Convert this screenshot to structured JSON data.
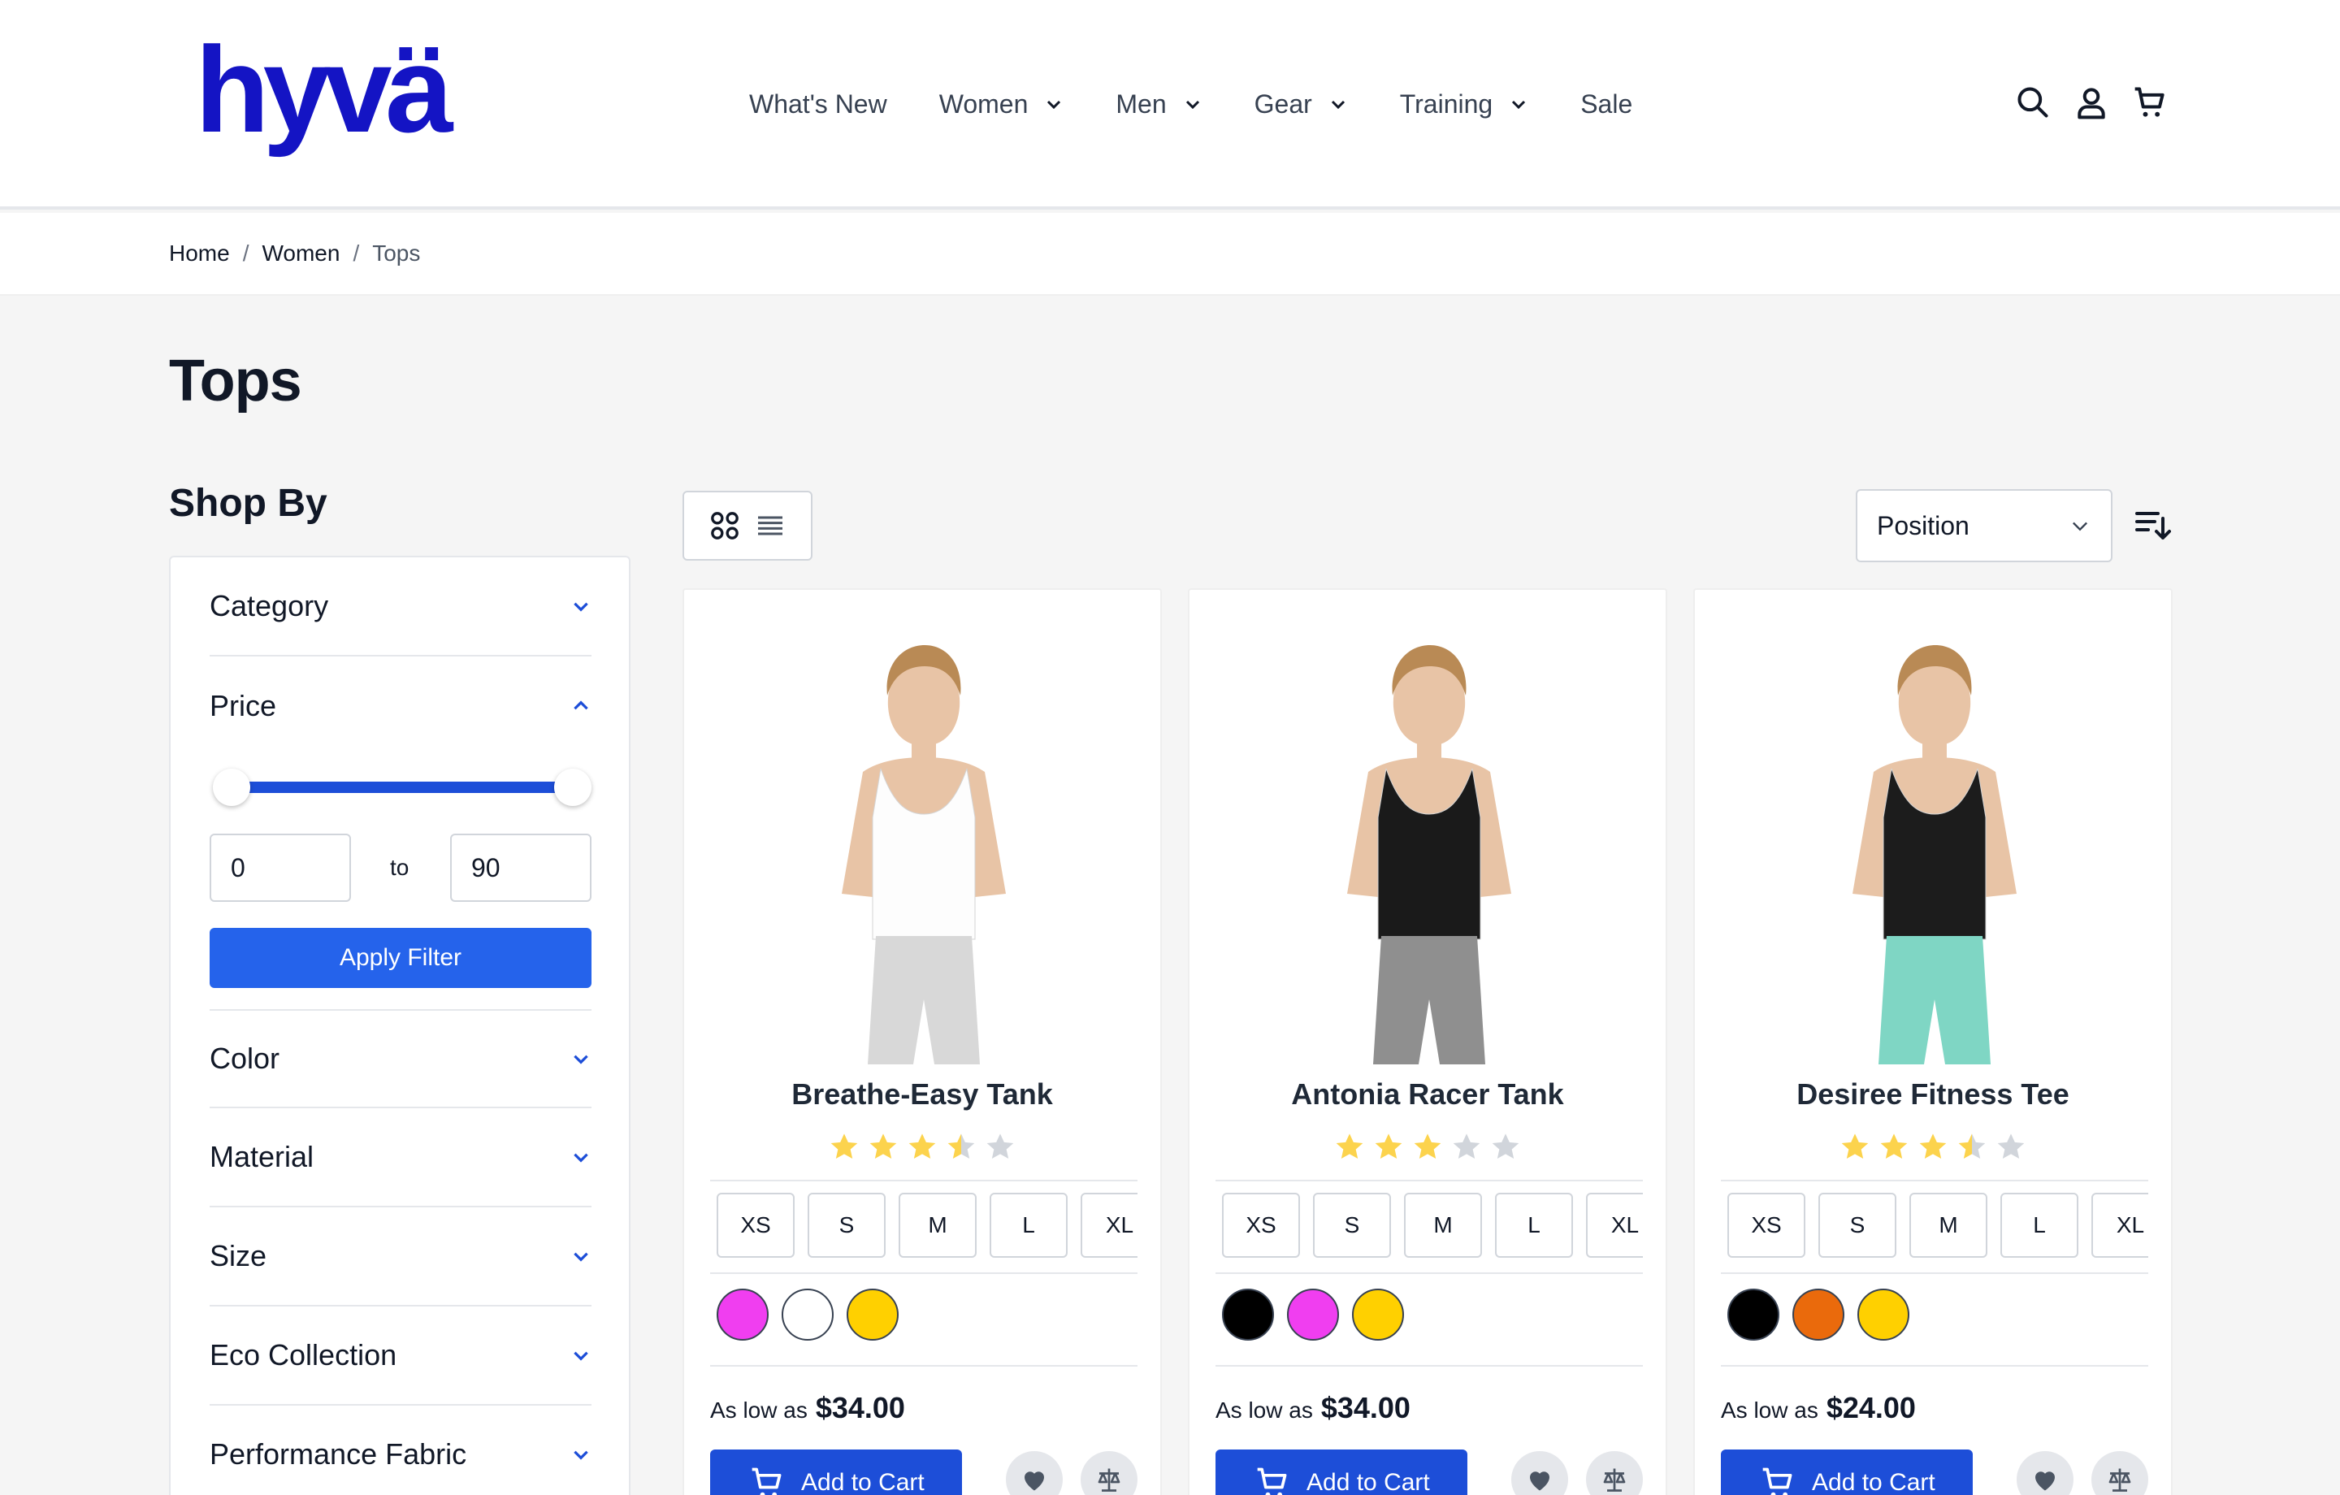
{
  "brand": {
    "logo_text": "hyvä",
    "color": "#1414c4"
  },
  "nav": {
    "items": [
      {
        "label": "What's New",
        "dropdown": false
      },
      {
        "label": "Women",
        "dropdown": true
      },
      {
        "label": "Men",
        "dropdown": true
      },
      {
        "label": "Gear",
        "dropdown": true
      },
      {
        "label": "Training",
        "dropdown": true
      },
      {
        "label": "Sale",
        "dropdown": false
      }
    ],
    "icons": [
      "search-icon",
      "user-icon",
      "cart-icon"
    ]
  },
  "breadcrumb": {
    "items": [
      "Home",
      "Women"
    ],
    "separator": "/",
    "current": "Tops"
  },
  "page": {
    "title": "Tops"
  },
  "sidebar": {
    "title": "Shop By",
    "filters": {
      "category": "Category",
      "price": "Price",
      "color": "Color",
      "material": "Material",
      "size": "Size",
      "eco": "Eco Collection",
      "performance": "Performance Fabric"
    },
    "price_range": {
      "min": "0",
      "max": "90",
      "to_label": "to",
      "apply_label": "Apply Filter"
    }
  },
  "toolbar": {
    "sort_label": "Position",
    "view_modes": [
      "grid-icon",
      "list-icon"
    ],
    "active_view": "grid"
  },
  "products": [
    {
      "name": "Breathe-Easy Tank",
      "rating": 3.5,
      "sizes": [
        "XS",
        "S",
        "M",
        "L",
        "XL"
      ],
      "colors": [
        "#f03ef0",
        "#ffffff",
        "#ffd000"
      ],
      "price_label": "As low as",
      "price": "$34.00",
      "add_label": "Add to Cart"
    },
    {
      "name": "Antonia Racer Tank",
      "rating": 3,
      "sizes": [
        "XS",
        "S",
        "M",
        "L",
        "XL"
      ],
      "colors": [
        "#000000",
        "#f03ef0",
        "#ffd000"
      ],
      "price_label": "As low as",
      "price": "$34.00",
      "add_label": "Add to Cart"
    },
    {
      "name": "Desiree Fitness Tee",
      "rating": 3.5,
      "sizes": [
        "XS",
        "S",
        "M",
        "L",
        "XL"
      ],
      "colors": [
        "#000000",
        "#ea6a0c",
        "#ffd000"
      ],
      "price_label": "As low as",
      "price": "$24.00",
      "add_label": "Add to Cart"
    }
  ],
  "colors": {
    "primary": "#2563eb",
    "button": "#1d4ed8",
    "star": "#fcd34d",
    "star_empty": "#d1d5db"
  }
}
